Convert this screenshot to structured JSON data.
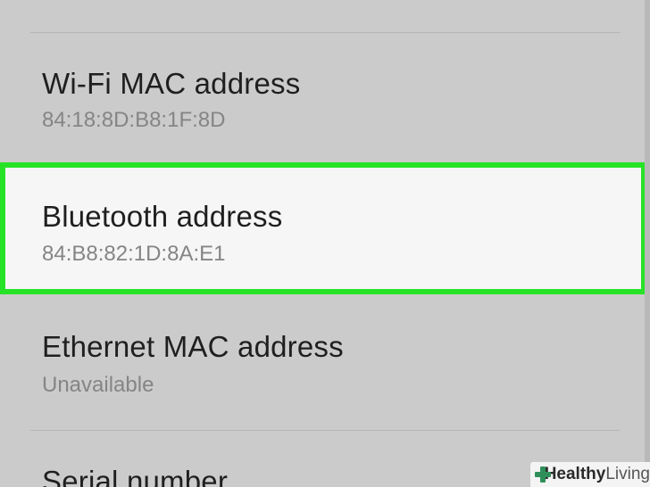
{
  "settings_list": {
    "items": [
      {
        "title": "Wi-Fi MAC address",
        "value": "84:18:8D:B8:1F:8D"
      },
      {
        "title": "Bluetooth address",
        "value": "84:B8:82:1D:8A:E1",
        "highlighted": true
      },
      {
        "title": "Ethernet MAC address",
        "value": "Unavailable"
      },
      {
        "title": "Serial number",
        "value": ""
      }
    ]
  },
  "watermark": {
    "brand_bold": "Healthy",
    "brand_light": "Living"
  },
  "colors": {
    "highlight_border": "#27e327",
    "background": "#cbcbcb",
    "highlight_bg": "#f6f6f6"
  }
}
